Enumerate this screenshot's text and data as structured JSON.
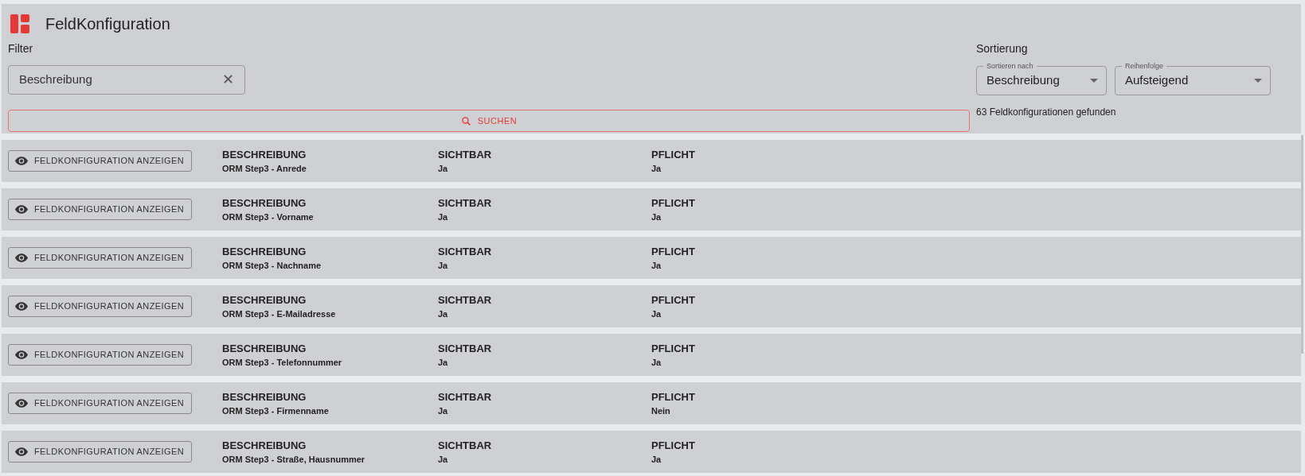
{
  "header": {
    "title": "FeldKonfiguration"
  },
  "filter": {
    "label": "Filter",
    "field": {
      "value": "Beschreibung",
      "clear": "✕"
    },
    "search_button": "SUCHEN"
  },
  "sorting": {
    "label": "Sortierung",
    "selects": [
      {
        "label": "Sortieren nach",
        "value": "Beschreibung"
      },
      {
        "label": "Reihenfolge",
        "value": "Aufsteigend"
      }
    ],
    "result_count": "63 Feldkonfigurationen gefunden"
  },
  "rows": [
    {
      "button": "FELDKONFIGURATION ANZEIGEN",
      "fields": [
        {
          "label": "BESCHREIBUNG",
          "value": "ORM Step3 - Anrede"
        },
        {
          "label": "SICHTBAR",
          "value": "Ja"
        },
        {
          "label": "PFLICHT",
          "value": "Ja"
        }
      ]
    },
    {
      "button": "FELDKONFIGURATION ANZEIGEN",
      "fields": [
        {
          "label": "BESCHREIBUNG",
          "value": "ORM Step3 - Vorname"
        },
        {
          "label": "SICHTBAR",
          "value": "Ja"
        },
        {
          "label": "PFLICHT",
          "value": "Ja"
        }
      ]
    },
    {
      "button": "FELDKONFIGURATION ANZEIGEN",
      "fields": [
        {
          "label": "BESCHREIBUNG",
          "value": "ORM Step3 - Nachname"
        },
        {
          "label": "SICHTBAR",
          "value": "Ja"
        },
        {
          "label": "PFLICHT",
          "value": "Ja"
        }
      ]
    },
    {
      "button": "FELDKONFIGURATION ANZEIGEN",
      "fields": [
        {
          "label": "BESCHREIBUNG",
          "value": "ORM Step3 - E-Mailadresse"
        },
        {
          "label": "SICHTBAR",
          "value": "Ja"
        },
        {
          "label": "PFLICHT",
          "value": "Ja"
        }
      ]
    },
    {
      "button": "FELDKONFIGURATION ANZEIGEN",
      "fields": [
        {
          "label": "BESCHREIBUNG",
          "value": "ORM Step3 - Telefonnummer"
        },
        {
          "label": "SICHTBAR",
          "value": "Ja"
        },
        {
          "label": "PFLICHT",
          "value": "Ja"
        }
      ]
    },
    {
      "button": "FELDKONFIGURATION ANZEIGEN",
      "fields": [
        {
          "label": "BESCHREIBUNG",
          "value": "ORM Step3 - Firmenname"
        },
        {
          "label": "SICHTBAR",
          "value": "Ja"
        },
        {
          "label": "PFLICHT",
          "value": "Nein"
        }
      ]
    },
    {
      "button": "FELDKONFIGURATION ANZEIGEN",
      "fields": [
        {
          "label": "BESCHREIBUNG",
          "value": "ORM Step3 - Straße, Hausnummer"
        },
        {
          "label": "SICHTBAR",
          "value": "Ja"
        },
        {
          "label": "PFLICHT",
          "value": "Ja"
        }
      ]
    }
  ]
}
